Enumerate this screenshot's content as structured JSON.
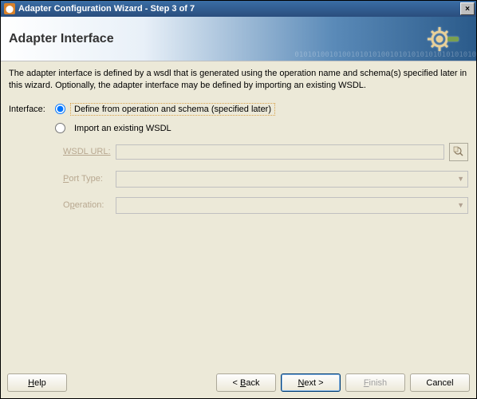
{
  "title": "Adapter Configuration Wizard - Step 3 of 7",
  "header": {
    "title": "Adapter Interface"
  },
  "description": "The adapter interface is defined by a wsdl that is generated using the operation name and schema(s) specified later in this wizard.  Optionally, the adapter interface may be defined by importing an existing WSDL.",
  "iface": {
    "label": "Interface:",
    "opt1": "Define from operation and schema (specified later)",
    "opt2": "Import an existing WSDL",
    "wsdl_label_pre": "W",
    "wsdl_label_mid": "S",
    "wsdl_label_post": "DL URL:",
    "wsdl_value": "",
    "port_label": "Port Type:",
    "op_label_pre": "O",
    "op_label_mid": "p",
    "op_label_post": "eration:"
  },
  "buttons": {
    "help_h": "H",
    "help_rest": "elp",
    "back_lt": "< ",
    "back_b": "B",
    "back_rest": "ack",
    "next_n": "N",
    "next_rest": "ext >",
    "finish_f": "F",
    "finish_rest": "inish",
    "cancel": "Cancel"
  }
}
